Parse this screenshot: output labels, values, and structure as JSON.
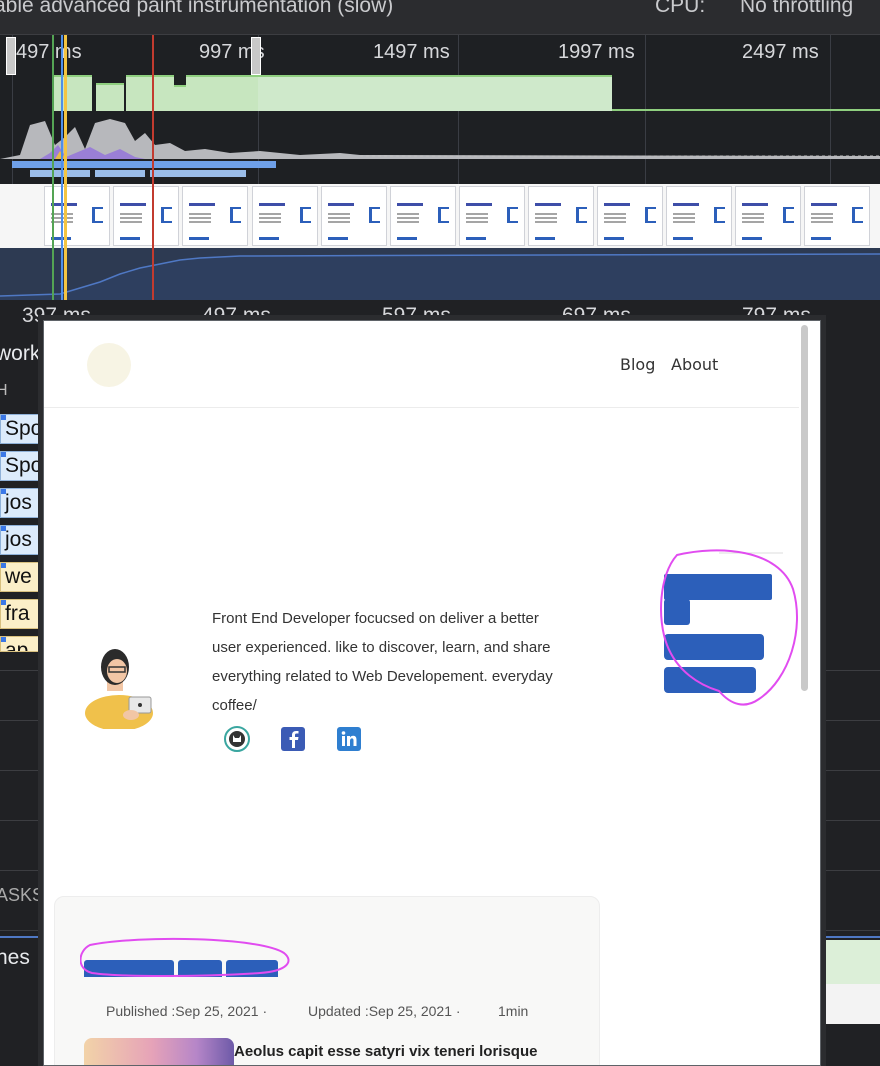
{
  "toolbar": {
    "paint_label": "able advanced paint instrumentation (slow)",
    "cpu_label": "CPU:",
    "cpu_value": "No throttling"
  },
  "overview": {
    "ticks": [
      "497 ms",
      "997 ms",
      "1497 ms",
      "1997 ms",
      "2497 ms"
    ]
  },
  "details": {
    "ticks": [
      "397 ms",
      "497 ms",
      "597 ms",
      "697 ms",
      "797 ms"
    ],
    "network_label": "work",
    "header_letter": "H",
    "rows": [
      "Spo",
      "Spo",
      "jos",
      "jos",
      "we",
      "fra",
      "ap"
    ],
    "tasks_label": "ASKS",
    "frames_label": "nes"
  },
  "popup": {
    "nav": [
      "Blog",
      "About"
    ],
    "bio": "Front End Developer focucsed on deliver a better user experienced. like to discover, learn, and share everything related to Web Developement. everyday coffee/",
    "social_icons": [
      "github-icon",
      "facebook-icon",
      "linkedin-icon"
    ],
    "published": "Published :Sep 25, 2021 ·",
    "updated": "Updated :Sep 25, 2021 ·",
    "read_time": "1min",
    "post_title": "Aeolus capit esse satyri vix teneri lorisque"
  },
  "colors": {
    "annotation": "#e14cf0",
    "brand_blue": "#2c5fba",
    "fps_green": "#c7e6bf"
  }
}
